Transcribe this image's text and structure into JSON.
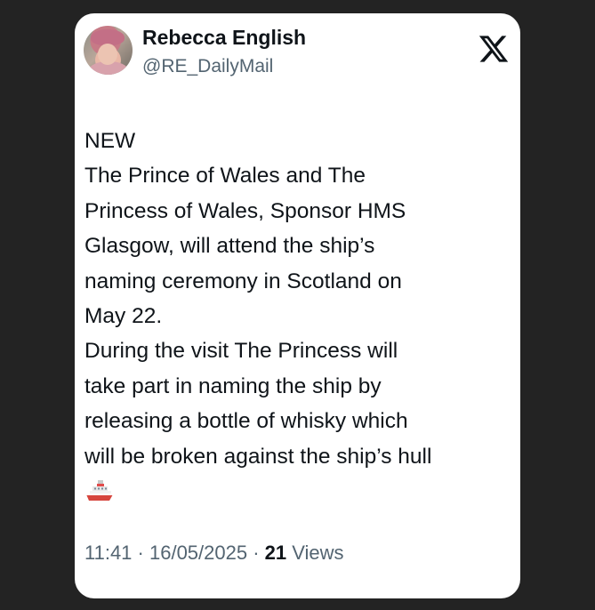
{
  "author": {
    "name": "Rebecca English",
    "handle": "@RE_DailyMail"
  },
  "tweet": {
    "lines": [
      "NEW",
      "The Prince of Wales and The",
      "Princess of Wales, Sponsor HMS",
      "Glasgow, will attend the ship’s",
      "naming ceremony in Scotland on",
      "May 22.",
      "During the visit The Princess will",
      "take part in naming the ship by",
      "releasing a bottle of whisky which",
      "will be broken against the ship’s hull"
    ],
    "emoji": "ship-icon"
  },
  "meta": {
    "time": "11:41",
    "sep1": " · ",
    "date": "16/05/2025",
    "sep2": " · ",
    "views_count": "21",
    "views_label": " Views"
  },
  "icons": {
    "brand": "x-logo-icon",
    "avatar": "avatar"
  },
  "colors": {
    "background": "#232323",
    "card": "#ffffff",
    "text_primary": "#0f1419",
    "text_secondary": "#536471"
  }
}
